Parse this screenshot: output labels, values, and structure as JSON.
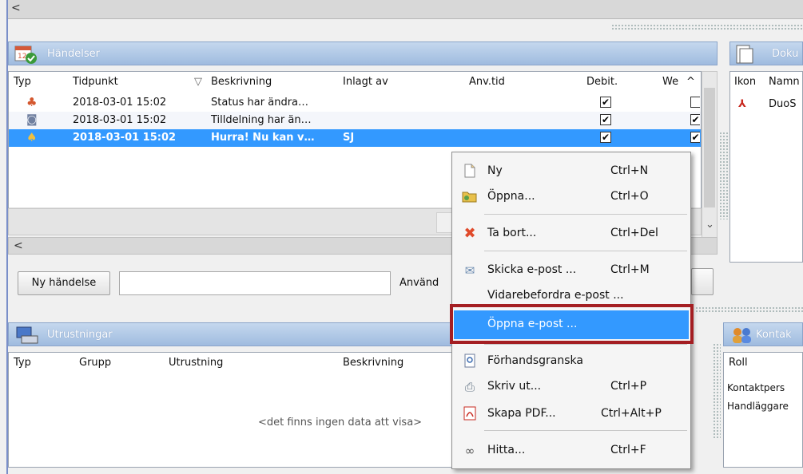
{
  "top_scroll": {
    "arrow": "<"
  },
  "events_panel": {
    "title": "Händelser",
    "columns": [
      "Typ",
      "Tidpunkt",
      "▽",
      "Beskrivning",
      "Inlagt av",
      "Anv.tid",
      "Debit.",
      "We",
      "^"
    ],
    "rows": [
      {
        "time": "2018-03-01 15:02",
        "description": "Status har ändra…",
        "by": "",
        "debit": "✔",
        "we": ""
      },
      {
        "time": "2018-03-01 15:02",
        "description": "Tilldelning har än…",
        "by": "",
        "debit": "✔",
        "we": "✔"
      },
      {
        "time": "2018-03-01 15:02",
        "description": "Hurra! Nu kan v…",
        "by": "SJ",
        "debit": "✔",
        "we": "✔"
      }
    ],
    "scroll_left": "<",
    "scroll_down": "⌄",
    "new_button": "Ny händelse",
    "search_value": "",
    "use_label": "Använd"
  },
  "documents_panel": {
    "title": "Doku",
    "columns": [
      "Ikon",
      "Namn"
    ],
    "rows": [
      {
        "name": "DuoS"
      }
    ]
  },
  "equipment_panel": {
    "title": "Utrustningar",
    "columns": [
      "Typ",
      "Grupp",
      "Utrustning",
      "Beskrivning"
    ],
    "empty_text": "<det finns ingen data att visa>"
  },
  "contacts_panel": {
    "title": "Kontak",
    "columns": [
      "Roll"
    ],
    "rows": [
      "Kontaktpers",
      "Handläggare"
    ]
  },
  "context_menu": {
    "items": [
      {
        "label": "Ny",
        "shortcut": "Ctrl+N",
        "icon": "new-page-icon"
      },
      {
        "label": "Öppna...",
        "shortcut": "Ctrl+O",
        "icon": "open-folder-icon"
      },
      {
        "label": "Ta bort...",
        "shortcut": "Ctrl+Del",
        "icon": "delete-x-icon"
      },
      {
        "label": "Skicka e-post ...",
        "shortcut": "Ctrl+M",
        "icon": "send-mail-icon"
      },
      {
        "label": "Vidarebefordra e-post ...",
        "shortcut": "",
        "icon": ""
      },
      {
        "label": "Öppna e-post ...",
        "shortcut": "",
        "icon": ""
      },
      {
        "label": "Förhandsgranska",
        "shortcut": "",
        "icon": "preview-icon"
      },
      {
        "label": "Skriv ut...",
        "shortcut": "Ctrl+P",
        "icon": "printer-icon"
      },
      {
        "label": "Skapa PDF...",
        "shortcut": "Ctrl+Alt+P",
        "icon": "pdf-icon"
      },
      {
        "label": "Hitta...",
        "shortcut": "Ctrl+F",
        "icon": "binoculars-icon"
      }
    ],
    "highlighted": "Öppna e-post ..."
  },
  "colors": {
    "selection": "#3399ff",
    "header_top": "#c5d8ee",
    "header_bottom": "#9fbbdf",
    "highlight_box": "#a41e22"
  }
}
